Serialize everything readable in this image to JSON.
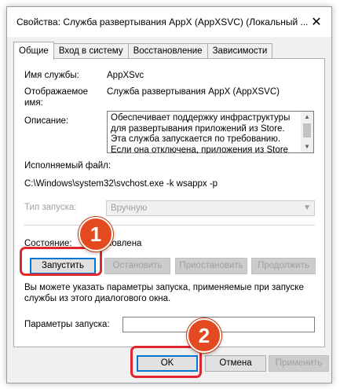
{
  "window": {
    "title": "Свойства: Служба развертывания AppX (AppXSVC) (Локальный ...",
    "close_glyph": "✕"
  },
  "tabs": [
    {
      "label": "Общие",
      "active": true
    },
    {
      "label": "Вход в систему",
      "active": false
    },
    {
      "label": "Восстановление",
      "active": false
    },
    {
      "label": "Зависимости",
      "active": false
    }
  ],
  "general": {
    "service_name_label": "Имя службы:",
    "service_name_value": "AppXSvc",
    "display_name_label_line1": "Отображаемое",
    "display_name_label_line2": "имя:",
    "display_name_value": "Служба развертывания AppX (AppXSVC)",
    "description_label": "Описание:",
    "description_text": "Обеспечивает поддержку инфраструктуры для развертывания приложений из Store. Эта служба запускается по требованию. Если она отключена, приложения из Store не будут",
    "executable_label": "Исполняемый файл:",
    "executable_value": "C:\\Windows\\system32\\svchost.exe -k wsappx -p",
    "startup_type_label": "Тип запуска:",
    "startup_type_value": "Вручную",
    "status_label": "Состояние:",
    "status_value_partial": "новлена"
  },
  "service_buttons": {
    "start": "Запустить",
    "stop": "Остановить",
    "pause": "Приостановить",
    "resume": "Продолжить"
  },
  "params": {
    "hint": "Вы можете указать параметры запуска, применяемые при запуске службы из этого диалогового окна.",
    "label": "Параметры запуска:",
    "value": ""
  },
  "footer": {
    "ok": "OK",
    "cancel": "Отмена",
    "apply": "Применить"
  },
  "annotations": {
    "badge1": "1",
    "badge2": "2",
    "highlight_color": "#e0262f",
    "badge_color": "#e34a1f"
  },
  "colors": {
    "focus_border": "#0078d7",
    "window_bg": "#f0f0f0",
    "disabled_text": "#a0a0a0"
  }
}
